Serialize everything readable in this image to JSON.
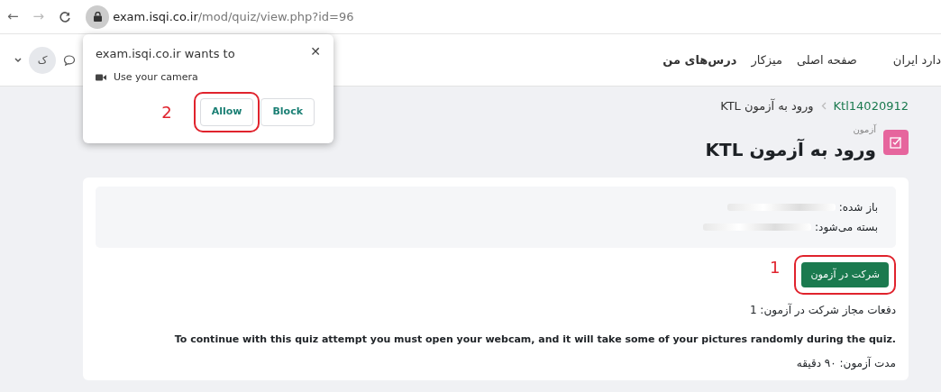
{
  "browser": {
    "back": "←",
    "forward": "→",
    "url_host": "exam.isqi.co.ir",
    "url_path": "/mod/quiz/view.php?id=96"
  },
  "navbar": {
    "site_name": "دارد ایران",
    "avatar": "ک",
    "links": [
      {
        "label": "صفحه اصلی",
        "selected": false
      },
      {
        "label": "میزکار",
        "selected": false
      },
      {
        "label": "درس‌های من",
        "selected": true
      }
    ]
  },
  "breadcrumb": [
    {
      "label": "Ktl14020912",
      "kind": "link"
    },
    {
      "label": "ورود به آزمون KTL",
      "kind": "current"
    }
  ],
  "page_header": {
    "module": "آزمون",
    "title": "ورود به آزمون KTL"
  },
  "info": [
    {
      "label": "باز شده:",
      "redacted": true
    },
    {
      "label": "بسته می‌شود:",
      "redacted": true
    }
  ],
  "start_button": {
    "label": "شرکت در آزمون",
    "marker": "1"
  },
  "attempts": "دفعات مجاز شرکت در آزمون: 1",
  "notice": "To continue with this quiz attempt you must open your webcam, and it will take some of your pictures randomly during the quiz.",
  "duration": "مدت آزمون: ۹۰ دقیقه",
  "permission_popup": {
    "close": "✕",
    "title": "exam.isqi.co.ir wants to",
    "request": "Use your camera",
    "marker": "2",
    "allow_button": {
      "label": "Allow",
      "highlighted": true
    },
    "block_button": {
      "label": "Block",
      "highlighted": false
    }
  }
}
